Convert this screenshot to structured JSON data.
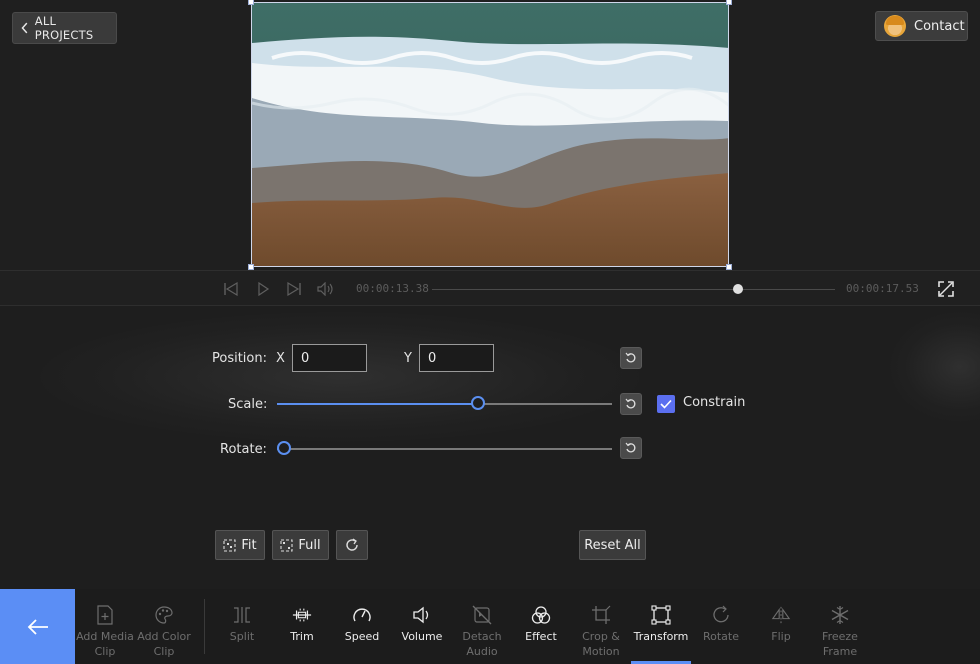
{
  "header": {
    "all_projects_label": "ALL PROJECTS",
    "contact_label": "Contact"
  },
  "playback": {
    "current_time": "00:00:13.38",
    "total_time": "00:00:17.53",
    "progress": 0.76
  },
  "transform": {
    "position_label": "Position:",
    "x_label": "X",
    "x_value": "0",
    "y_label": "Y",
    "y_value": "0",
    "scale_label": "Scale:",
    "scale_level": 0.6,
    "constrain_label": "Constrain",
    "constrain_checked": true,
    "rotate_label": "Rotate:",
    "rotate_level": 0.0,
    "fit_label": "Fit",
    "full_label": "Full",
    "reset_all_label": "Reset All"
  },
  "toolbar": {
    "items": [
      {
        "label": "Add Media\nClip",
        "icon": "add-media-icon"
      },
      {
        "label": "Add Color\nClip",
        "icon": "palette-icon"
      },
      {
        "label": "Split",
        "icon": "split-icon"
      },
      {
        "label": "Trim",
        "icon": "trim-icon"
      },
      {
        "label": "Speed",
        "icon": "speed-icon"
      },
      {
        "label": "Volume",
        "icon": "volume-icon"
      },
      {
        "label": "Detach\nAudio",
        "icon": "detach-audio-icon"
      },
      {
        "label": "Effect",
        "icon": "effect-icon"
      },
      {
        "label": "Crop &\nMotion",
        "icon": "crop-icon"
      },
      {
        "label": "Transform",
        "icon": "transform-icon"
      },
      {
        "label": "Rotate",
        "icon": "rotate-icon"
      },
      {
        "label": "Flip",
        "icon": "flip-icon"
      },
      {
        "label": "Freeze\nFrame",
        "icon": "snowflake-icon"
      }
    ]
  },
  "colors": {
    "accent": "#5b8ef5",
    "checkbox": "#5b6ff0",
    "background": "#1e1e1e"
  }
}
